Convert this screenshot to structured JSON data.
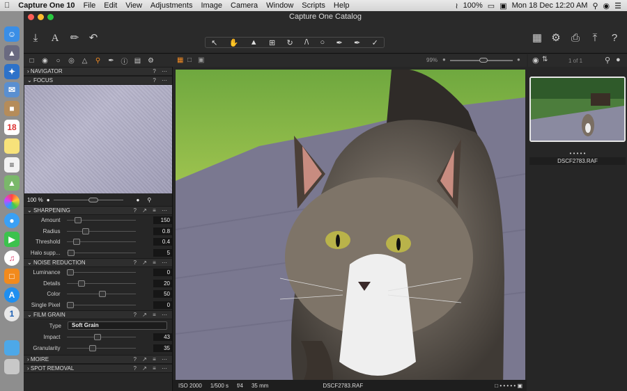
{
  "menubar": {
    "app_name": "Capture One 10",
    "items": [
      "File",
      "Edit",
      "View",
      "Adjustments",
      "Image",
      "Camera",
      "Window",
      "Scripts",
      "Help"
    ],
    "battery": "100%",
    "clock": "Mon 18 Dec  12:20 AM"
  },
  "window": {
    "title": "Capture One Catalog"
  },
  "viewer": {
    "zoom": "99%",
    "file_name": "DSCF2783.RAF",
    "iso": "ISO 2000",
    "shutter": "1/500 s",
    "aperture": "f/4",
    "focal": "35 mm"
  },
  "browser": {
    "counter": "1 of 1",
    "thumb_name": "DSCF2783.RAF",
    "rating_dots": "• • • • •"
  },
  "panels": {
    "navigator": "NAVIGATOR",
    "focus": "FOCUS",
    "focus_zoom": "100 %",
    "sharpening": {
      "title": "SHARPENING",
      "rows": [
        {
          "label": "Amount",
          "value": "150",
          "pos": 0.12
        },
        {
          "label": "Radius",
          "value": "0.8",
          "pos": 0.24
        },
        {
          "label": "Threshold",
          "value": "0.4",
          "pos": 0.1
        },
        {
          "label": "Halo supp...",
          "value": "5",
          "pos": 0.02
        }
      ]
    },
    "noise": {
      "title": "NOISE REDUCTION",
      "rows": [
        {
          "label": "Luminance",
          "value": "0",
          "pos": 0.0
        },
        {
          "label": "Details",
          "value": "20",
          "pos": 0.18
        },
        {
          "label": "Color",
          "value": "50",
          "pos": 0.5
        },
        {
          "label": "Single Pixel",
          "value": "0",
          "pos": 0.0
        }
      ]
    },
    "grain": {
      "title": "FILM GRAIN",
      "type_label": "Type",
      "type_value": "Soft Grain",
      "rows": [
        {
          "label": "Impact",
          "value": "43",
          "pos": 0.43
        },
        {
          "label": "Granularity",
          "value": "35",
          "pos": 0.35
        }
      ]
    },
    "moire": "MOIRE",
    "spot": "SPOT REMOVAL"
  },
  "icons": {
    "toolbar": [
      "import-icon",
      "text-icon",
      "brush-icon",
      "undo-icon"
    ],
    "right": [
      "grid-icon",
      "gear-icon",
      "print-icon",
      "export-icon",
      "help-icon"
    ]
  },
  "colors": {
    "accent": "#f08a24",
    "panel": "#262626"
  }
}
